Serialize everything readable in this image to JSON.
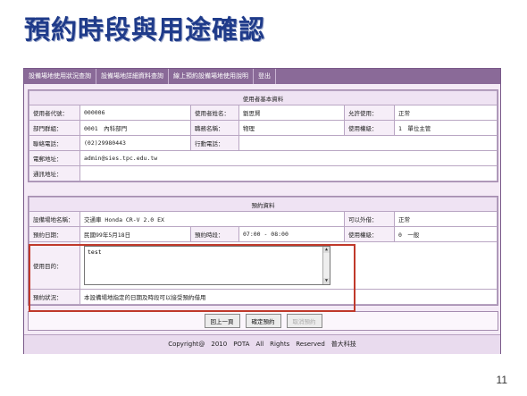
{
  "slide": {
    "title": "預約時段與用途確認",
    "page_number": "11"
  },
  "nav": {
    "items": [
      "設備場地使用狀況查詢",
      "設備場地詳細資料查詢",
      "線上預約設備場地使用說明",
      "登出"
    ]
  },
  "user_info": {
    "header": "使用者基本資料",
    "code_label": "使用者代號：",
    "code_value": "000006",
    "name_label": "使用者姓名：",
    "name_value": "劉思賢",
    "permit_label": "允許使用：",
    "permit_value": "正常",
    "dept_label": "部門群組：",
    "dept_value": "0001　內科部門",
    "title_label": "職務名稱：",
    "title_value": "物理",
    "level_label": "使用權級：",
    "level_value": "1　單位主管",
    "phone_label": "聯絡電話：",
    "phone_value": "(02)29980443",
    "mobile_label": "行動電話：",
    "mobile_value": "",
    "email_label": "電郵地址：",
    "email_value": "admin@sies.tpc.edu.tw",
    "address_label": "通訊地址：",
    "address_value": ""
  },
  "booking": {
    "header": "預約資料",
    "facility_label": "設備場地名稱：",
    "facility_value": "交通車 Honda CR-V 2.0 EX",
    "lend_label": "可以外借：",
    "lend_value": "正常",
    "date_label": "預約日期：",
    "date_value": "民國99年5月18日",
    "time_label": "預約時段：",
    "time_value": "07:00 - 08:00",
    "level_label": "使用權級：",
    "level_value": "0　一般",
    "purpose_label": "使用目的：",
    "purpose_value": "test",
    "status_label": "預約狀況：",
    "status_value": "本設備場地指定的日期及時段可以接受預約借用"
  },
  "buttons": {
    "back": "回上一頁",
    "confirm": "確定預約",
    "cancel": "取消預約"
  },
  "footer": {
    "text": "Copyright@　2010　POTA　All　Rights　Reserved　普大科技"
  },
  "colors": {
    "title": "#1f3b8a",
    "nav": "#8a6a98",
    "highlight": "#c0392b",
    "status_text": "#1a2aa8"
  }
}
